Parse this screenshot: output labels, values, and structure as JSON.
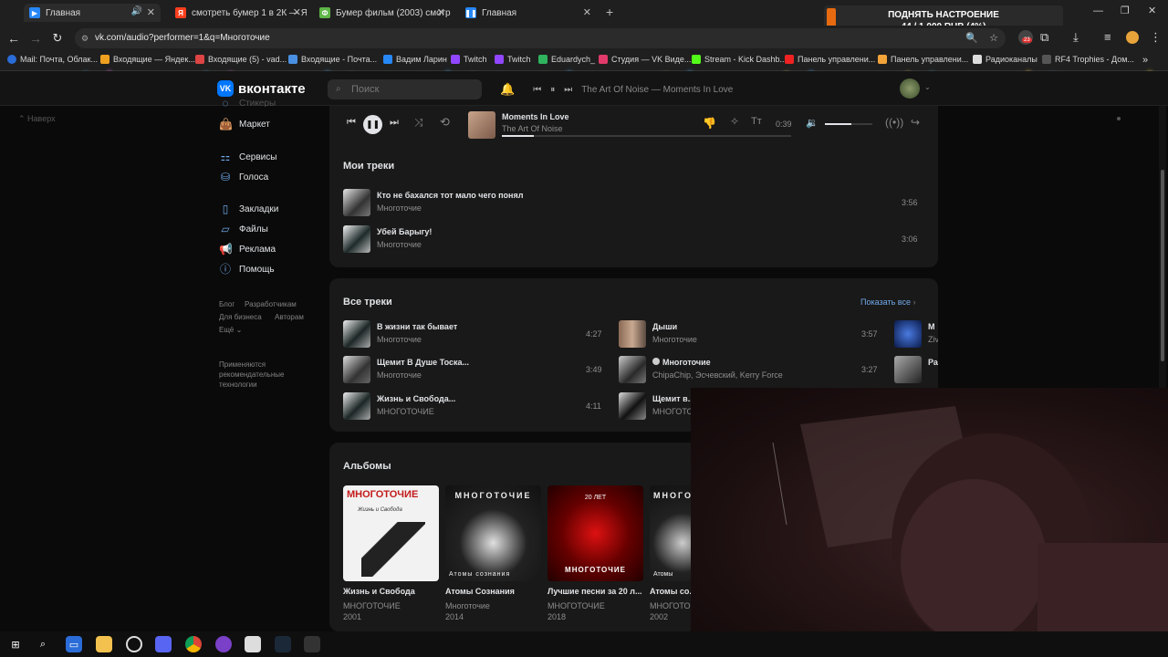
{
  "browser": {
    "tabs": [
      {
        "title": "Главная",
        "favicon_color": "#2787f5"
      },
      {
        "title": "смотреть бумер 1 в 2К — Янд",
        "favicon_color": "#fc3f1d"
      },
      {
        "title": "Бумер фильм (2003) смотреть",
        "favicon_color": "#5eb548"
      },
      {
        "title": "Главная",
        "favicon_color": "#2787f5"
      }
    ],
    "url": "vk.com/audio?performer=1&q=Многоточие",
    "bookmarks": [
      "Mail: Почта, Облак...",
      "Входящие — Яндек...",
      "Входящие (5) - vad...",
      "Входящие - Почта...",
      "Вадим Ларин",
      "Twitch",
      "Twitch",
      "Eduardych_",
      "Студия — VK Виде...",
      "Stream - Kick Dashb...",
      "Панель управлени...",
      "Панель управлени...",
      "Радиоканалы",
      "RF4 Trophies - Дом..."
    ],
    "badge_count": "23"
  },
  "donation": {
    "line1": "ПОДНЯТЬ НАСТРОЕНИЕ",
    "line2": "44 / 1 000 RUB (4%)"
  },
  "vk": {
    "logo_text": "вконтакте",
    "search_placeholder": "Поиск",
    "now_playing_header": "The Art Of Noise — Moments In Love",
    "back_label": "Наверх",
    "sidebar": {
      "partial_item": "Стикеры",
      "market": "Маркет",
      "services": "Сервисы",
      "voices": "Голоса",
      "bookmarks": "Закладки",
      "files": "Файлы",
      "ads": "Реклама",
      "help": "Помощь",
      "footer": {
        "blog": "Блог",
        "devs": "Разработчикам",
        "business": "Для бизнеса",
        "authors": "Авторам",
        "more": "Ещё",
        "recommend": "Применяются рекомендательные технологии"
      }
    },
    "player": {
      "title": "Moments In Love",
      "artist": "The Art Of Noise",
      "time": "0:39",
      "progress": 0.11,
      "volume": 0.55
    },
    "my_tracks": {
      "heading": "Мои треки",
      "items": [
        {
          "title": "Кто не бахался тот мало чего понял",
          "artist": "Многоточие",
          "duration": "3:56"
        },
        {
          "title": "Убей Барыгу!",
          "artist": "Многоточие",
          "duration": "3:06"
        }
      ]
    },
    "all_tracks": {
      "heading": "Все треки",
      "show_all": "Показать все",
      "col1": [
        {
          "title": "В жизни так бывает",
          "artist": "Многоточие",
          "duration": "4:27"
        },
        {
          "title": "Щемит В Душе Тоска...",
          "artist": "Многоточие",
          "duration": "3:49"
        },
        {
          "title": "Жизнь и Свобода...",
          "artist": "МНОГОТОЧИЕ",
          "duration": "4:11"
        }
      ],
      "col2": [
        {
          "title": "Дыши",
          "artist": "Многоточие",
          "duration": "3:57"
        },
        {
          "title": "Многоточие",
          "artist": "ChipaChip, Эсчевский, Kerry Force",
          "duration": "3:27"
        },
        {
          "title": "Щемит в...",
          "artist": "МНОГОТО"
        }
      ],
      "col3": [
        {
          "title": "М",
          "artist": "Ziv"
        },
        {
          "title": "Ра",
          "artist": ""
        }
      ]
    },
    "albums": {
      "heading": "Альбомы",
      "items": [
        {
          "title": "Жизнь и Свобода",
          "artist": "МНОГОТОЧИЕ",
          "year": "2001",
          "cover_text": "МНОГОТОЧИЕ",
          "cover_sub": "Жизнь и Свобода"
        },
        {
          "title": "Атомы Сознания",
          "artist": "Многоточие",
          "year": "2014",
          "cover_text": "МНОГОТОЧИЕ",
          "cover_sub": "Атомы сознания"
        },
        {
          "title": "Лучшие песни за 20 л...",
          "artist": "МНОГОТОЧИЕ",
          "year": "2018",
          "cover_text": "МНОГОТОЧИЕ",
          "cover_sub": "20 ЛЕТ"
        },
        {
          "title": "Атомы со...",
          "artist": "МНОГОТО",
          "year": "2002",
          "cover_text": "МНОГОТ",
          "cover_sub": "Атомы"
        }
      ]
    }
  },
  "colors": {
    "vk_blue": "#0077ff",
    "link_blue": "#71aaeb",
    "card_bg": "#191919",
    "bg": "#0a0a0a"
  }
}
